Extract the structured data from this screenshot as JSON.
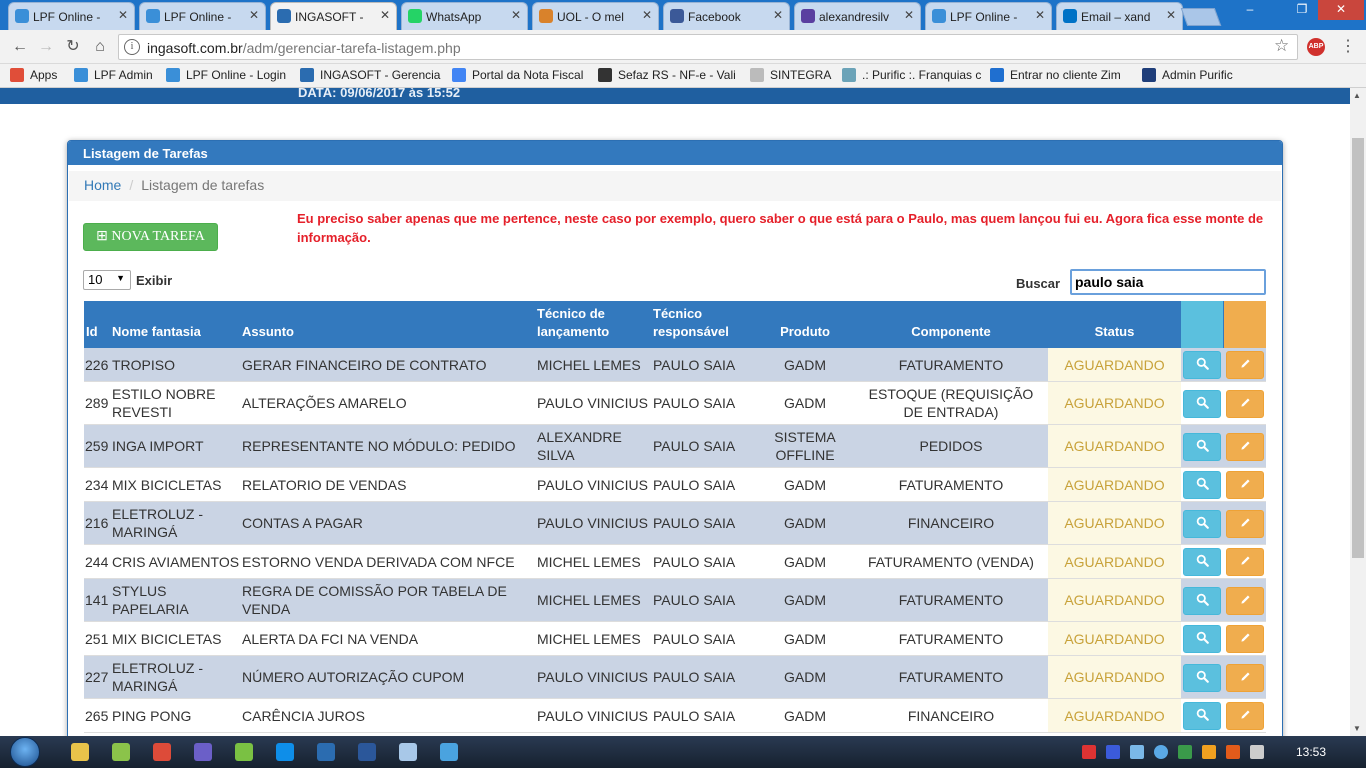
{
  "browser": {
    "tabs": [
      {
        "label": "LPF Online -",
        "color": "#3a8fd8",
        "active": false
      },
      {
        "label": "LPF Online -",
        "color": "#3a8fd8",
        "active": false
      },
      {
        "label": "INGASOFT - ",
        "color": "#2b6cb0",
        "active": true
      },
      {
        "label": "WhatsApp",
        "color": "#25d366",
        "active": false
      },
      {
        "label": "UOL - O mel",
        "color": "#d9822b",
        "active": false
      },
      {
        "label": "Facebook",
        "color": "#3b5998",
        "active": false
      },
      {
        "label": "alexandresilv",
        "color": "#5a3fa0",
        "active": false
      },
      {
        "label": "LPF Online -",
        "color": "#3a8fd8",
        "active": false
      },
      {
        "label": "Email – xand",
        "color": "#0072c6",
        "active": false
      }
    ],
    "url_host": "ingasoft.com.br",
    "url_path": "/adm/gerenciar-tarefa-listagem.php",
    "abp_label": "ABP",
    "bookmarks": [
      {
        "label": "Apps",
        "color": "#e04e39"
      },
      {
        "label": "LPF Admin",
        "color": "#3a8fd8"
      },
      {
        "label": "LPF Online - Login",
        "color": "#3a8fd8"
      },
      {
        "label": "INGASOFT - Gerencia",
        "color": "#2b6cb0"
      },
      {
        "label": "Portal da Nota Fiscal",
        "color": "#4285f4"
      },
      {
        "label": "Sefaz RS - NF-e - Vali",
        "color": "#333333"
      },
      {
        "label": "SINTEGRA",
        "color": "#bbbbbb"
      },
      {
        "label": ".: Purific :. Franquias c",
        "color": "#6ba3b8"
      },
      {
        "label": "Entrar no cliente Zim",
        "color": "#1f6fd0"
      },
      {
        "label": "Admin Purific",
        "color": "#1f3e7a"
      }
    ]
  },
  "page": {
    "top_strip_text": "DATA: 09/06/2017 às 15:52",
    "panel_title": "Listagem de Tarefas",
    "breadcrumb_home": "Home",
    "breadcrumb_current": "Listagem de tarefas",
    "new_task_button": "NOVA TAREFA",
    "note": "Eu preciso saber apenas que me pertence, neste caso por exemplo, quero saber o que está para o Paulo, mas quem lançou fui eu. Agora fica esse monte de informação.",
    "page_length": "10",
    "page_length_label": "Exibir",
    "search_label": "Buscar",
    "search_value": "paulo saia"
  },
  "table": {
    "headers": {
      "id": "Id",
      "nome": "Nome fantasia",
      "assunto": "Assunto",
      "tec_lanc": "Técnico de lançamento",
      "tec_resp": "Técnico responsável",
      "produto": "Produto",
      "componente": "Componente",
      "status": "Status"
    },
    "rows": [
      {
        "id": "226",
        "nome": "TROPISO",
        "assunto": "GERAR FINANCEIRO DE CONTRATO",
        "tec_lanc": "MICHEL LEMES",
        "tec_resp": "PAULO SAIA",
        "produto": "GADM",
        "componente": "FATURAMENTO",
        "status": "AGUARDANDO"
      },
      {
        "id": "289",
        "nome": "ESTILO NOBRE REVESTI",
        "assunto": "ALTERAÇÕES AMARELO",
        "tec_lanc": "PAULO VINICIUS",
        "tec_resp": "PAULO SAIA",
        "produto": "GADM",
        "componente": "ESTOQUE (REQUISIÇÃO DE ENTRADA)",
        "status": "AGUARDANDO"
      },
      {
        "id": "259",
        "nome": "INGA IMPORT",
        "assunto": "REPRESENTANTE NO MÓDULO: PEDIDO",
        "tec_lanc": "ALEXANDRE SILVA",
        "tec_resp": "PAULO SAIA",
        "produto": "SISTEMA OFFLINE",
        "componente": "PEDIDOS",
        "status": "AGUARDANDO"
      },
      {
        "id": "234",
        "nome": "MIX BICICLETAS",
        "assunto": "RELATORIO DE VENDAS",
        "tec_lanc": "PAULO VINICIUS",
        "tec_resp": "PAULO SAIA",
        "produto": "GADM",
        "componente": "FATURAMENTO",
        "status": "AGUARDANDO"
      },
      {
        "id": "216",
        "nome": "ELETROLUZ - MARINGÁ",
        "assunto": "CONTAS A PAGAR",
        "tec_lanc": "PAULO VINICIUS",
        "tec_resp": "PAULO SAIA",
        "produto": "GADM",
        "componente": "FINANCEIRO",
        "status": "AGUARDANDO"
      },
      {
        "id": "244",
        "nome": "CRIS AVIAMENTOS",
        "assunto": "ESTORNO VENDA DERIVADA COM NFCE",
        "tec_lanc": "MICHEL LEMES",
        "tec_resp": "PAULO SAIA",
        "produto": "GADM",
        "componente": "FATURAMENTO (VENDA)",
        "status": "AGUARDANDO"
      },
      {
        "id": "141",
        "nome": "STYLUS PAPELARIA",
        "assunto": "REGRA DE COMISSÃO POR TABELA DE VENDA",
        "tec_lanc": "MICHEL LEMES",
        "tec_resp": "PAULO SAIA",
        "produto": "GADM",
        "componente": "FATURAMENTO",
        "status": "AGUARDANDO"
      },
      {
        "id": "251",
        "nome": "MIX BICICLETAS",
        "assunto": "ALERTA DA FCI NA VENDA",
        "tec_lanc": "MICHEL LEMES",
        "tec_resp": "PAULO SAIA",
        "produto": "GADM",
        "componente": "FATURAMENTO",
        "status": "AGUARDANDO"
      },
      {
        "id": "227",
        "nome": "ELETROLUZ - MARINGÁ",
        "assunto": "NÚMERO AUTORIZAÇÃO CUPOM",
        "tec_lanc": "PAULO VINICIUS",
        "tec_resp": "PAULO SAIA",
        "produto": "GADM",
        "componente": "FATURAMENTO",
        "status": "AGUARDANDO"
      },
      {
        "id": "265",
        "nome": "PING PONG",
        "assunto": "CARÊNCIA JUROS",
        "tec_lanc": "PAULO VINICIUS",
        "tec_resp": "PAULO SAIA",
        "produto": "GADM",
        "componente": "FINANCEIRO",
        "status": "AGUARDANDO"
      }
    ]
  },
  "taskbar": {
    "clock": "13:53",
    "apps": [
      {
        "name": "explorer",
        "color": "#e8c34a"
      },
      {
        "name": "contacts",
        "color": "#8bc34a"
      },
      {
        "name": "chrome",
        "color": "#dd4b39"
      },
      {
        "name": "remote",
        "color": "#6b5fc8"
      },
      {
        "name": "green-app",
        "color": "#7ac143"
      },
      {
        "name": "teamviewer",
        "color": "#0e8ee9"
      },
      {
        "name": "ingasoft",
        "color": "#2b6cb0"
      },
      {
        "name": "word",
        "color": "#2b579a"
      },
      {
        "name": "notepad",
        "color": "#a8c8e8"
      },
      {
        "name": "tool",
        "color": "#4aa3df"
      }
    ]
  }
}
